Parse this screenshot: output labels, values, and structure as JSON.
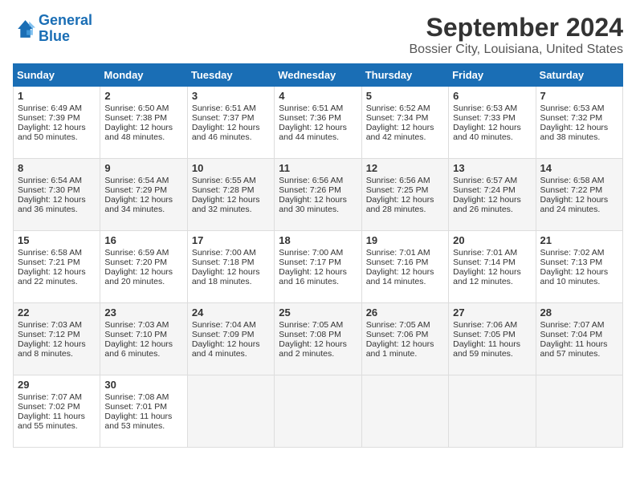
{
  "header": {
    "logo_line1": "General",
    "logo_line2": "Blue",
    "title": "September 2024",
    "subtitle": "Bossier City, Louisiana, United States"
  },
  "days_of_week": [
    "Sunday",
    "Monday",
    "Tuesday",
    "Wednesday",
    "Thursday",
    "Friday",
    "Saturday"
  ],
  "weeks": [
    [
      {
        "day": 1,
        "lines": [
          "Sunrise: 6:49 AM",
          "Sunset: 7:39 PM",
          "Daylight: 12 hours",
          "and 50 minutes."
        ]
      },
      {
        "day": 2,
        "lines": [
          "Sunrise: 6:50 AM",
          "Sunset: 7:38 PM",
          "Daylight: 12 hours",
          "and 48 minutes."
        ]
      },
      {
        "day": 3,
        "lines": [
          "Sunrise: 6:51 AM",
          "Sunset: 7:37 PM",
          "Daylight: 12 hours",
          "and 46 minutes."
        ]
      },
      {
        "day": 4,
        "lines": [
          "Sunrise: 6:51 AM",
          "Sunset: 7:36 PM",
          "Daylight: 12 hours",
          "and 44 minutes."
        ]
      },
      {
        "day": 5,
        "lines": [
          "Sunrise: 6:52 AM",
          "Sunset: 7:34 PM",
          "Daylight: 12 hours",
          "and 42 minutes."
        ]
      },
      {
        "day": 6,
        "lines": [
          "Sunrise: 6:53 AM",
          "Sunset: 7:33 PM",
          "Daylight: 12 hours",
          "and 40 minutes."
        ]
      },
      {
        "day": 7,
        "lines": [
          "Sunrise: 6:53 AM",
          "Sunset: 7:32 PM",
          "Daylight: 12 hours",
          "and 38 minutes."
        ]
      }
    ],
    [
      {
        "day": 8,
        "lines": [
          "Sunrise: 6:54 AM",
          "Sunset: 7:30 PM",
          "Daylight: 12 hours",
          "and 36 minutes."
        ]
      },
      {
        "day": 9,
        "lines": [
          "Sunrise: 6:54 AM",
          "Sunset: 7:29 PM",
          "Daylight: 12 hours",
          "and 34 minutes."
        ]
      },
      {
        "day": 10,
        "lines": [
          "Sunrise: 6:55 AM",
          "Sunset: 7:28 PM",
          "Daylight: 12 hours",
          "and 32 minutes."
        ]
      },
      {
        "day": 11,
        "lines": [
          "Sunrise: 6:56 AM",
          "Sunset: 7:26 PM",
          "Daylight: 12 hours",
          "and 30 minutes."
        ]
      },
      {
        "day": 12,
        "lines": [
          "Sunrise: 6:56 AM",
          "Sunset: 7:25 PM",
          "Daylight: 12 hours",
          "and 28 minutes."
        ]
      },
      {
        "day": 13,
        "lines": [
          "Sunrise: 6:57 AM",
          "Sunset: 7:24 PM",
          "Daylight: 12 hours",
          "and 26 minutes."
        ]
      },
      {
        "day": 14,
        "lines": [
          "Sunrise: 6:58 AM",
          "Sunset: 7:22 PM",
          "Daylight: 12 hours",
          "and 24 minutes."
        ]
      }
    ],
    [
      {
        "day": 15,
        "lines": [
          "Sunrise: 6:58 AM",
          "Sunset: 7:21 PM",
          "Daylight: 12 hours",
          "and 22 minutes."
        ]
      },
      {
        "day": 16,
        "lines": [
          "Sunrise: 6:59 AM",
          "Sunset: 7:20 PM",
          "Daylight: 12 hours",
          "and 20 minutes."
        ]
      },
      {
        "day": 17,
        "lines": [
          "Sunrise: 7:00 AM",
          "Sunset: 7:18 PM",
          "Daylight: 12 hours",
          "and 18 minutes."
        ]
      },
      {
        "day": 18,
        "lines": [
          "Sunrise: 7:00 AM",
          "Sunset: 7:17 PM",
          "Daylight: 12 hours",
          "and 16 minutes."
        ]
      },
      {
        "day": 19,
        "lines": [
          "Sunrise: 7:01 AM",
          "Sunset: 7:16 PM",
          "Daylight: 12 hours",
          "and 14 minutes."
        ]
      },
      {
        "day": 20,
        "lines": [
          "Sunrise: 7:01 AM",
          "Sunset: 7:14 PM",
          "Daylight: 12 hours",
          "and 12 minutes."
        ]
      },
      {
        "day": 21,
        "lines": [
          "Sunrise: 7:02 AM",
          "Sunset: 7:13 PM",
          "Daylight: 12 hours",
          "and 10 minutes."
        ]
      }
    ],
    [
      {
        "day": 22,
        "lines": [
          "Sunrise: 7:03 AM",
          "Sunset: 7:12 PM",
          "Daylight: 12 hours",
          "and 8 minutes."
        ]
      },
      {
        "day": 23,
        "lines": [
          "Sunrise: 7:03 AM",
          "Sunset: 7:10 PM",
          "Daylight: 12 hours",
          "and 6 minutes."
        ]
      },
      {
        "day": 24,
        "lines": [
          "Sunrise: 7:04 AM",
          "Sunset: 7:09 PM",
          "Daylight: 12 hours",
          "and 4 minutes."
        ]
      },
      {
        "day": 25,
        "lines": [
          "Sunrise: 7:05 AM",
          "Sunset: 7:08 PM",
          "Daylight: 12 hours",
          "and 2 minutes."
        ]
      },
      {
        "day": 26,
        "lines": [
          "Sunrise: 7:05 AM",
          "Sunset: 7:06 PM",
          "Daylight: 12 hours",
          "and 1 minute."
        ]
      },
      {
        "day": 27,
        "lines": [
          "Sunrise: 7:06 AM",
          "Sunset: 7:05 PM",
          "Daylight: 11 hours",
          "and 59 minutes."
        ]
      },
      {
        "day": 28,
        "lines": [
          "Sunrise: 7:07 AM",
          "Sunset: 7:04 PM",
          "Daylight: 11 hours",
          "and 57 minutes."
        ]
      }
    ],
    [
      {
        "day": 29,
        "lines": [
          "Sunrise: 7:07 AM",
          "Sunset: 7:02 PM",
          "Daylight: 11 hours",
          "and 55 minutes."
        ]
      },
      {
        "day": 30,
        "lines": [
          "Sunrise: 7:08 AM",
          "Sunset: 7:01 PM",
          "Daylight: 11 hours",
          "and 53 minutes."
        ]
      },
      null,
      null,
      null,
      null,
      null
    ]
  ]
}
